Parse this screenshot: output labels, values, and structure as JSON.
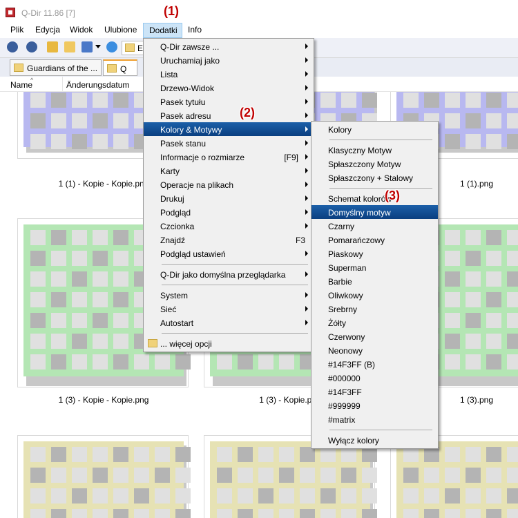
{
  "window": {
    "title": "Q-Dir 11.86 [7]"
  },
  "menubar": {
    "items": [
      "Plik",
      "Edycja",
      "Widok",
      "Ulubione",
      "Dodatki",
      "Info"
    ]
  },
  "address": {
    "value": "Ex"
  },
  "tabs": [
    {
      "label": "Guardians of the ..."
    },
    {
      "label": "Q"
    }
  ],
  "columns": {
    "name": "Name",
    "date": "Änderungsdatum"
  },
  "files": [
    {
      "name": "1 (1) - Kopie - Kopie.png"
    },
    {
      "name": "1 (1).png"
    },
    {
      "name": "1 (3) - Kopie - Kopie.png"
    },
    {
      "name": "1 (3) - Kopie.png"
    },
    {
      "name": "1 (3).png"
    }
  ],
  "dodatki_menu": [
    {
      "label": "Q-Dir zawsze ...",
      "submenu": true
    },
    {
      "label": "Uruchamiaj jako",
      "submenu": true
    },
    {
      "label": "Lista",
      "submenu": true
    },
    {
      "label": "Drzewo-Widok",
      "submenu": true
    },
    {
      "label": "Pasek tytułu",
      "submenu": true
    },
    {
      "label": "Pasek adresu",
      "submenu": true
    },
    {
      "label": "Kolory & Motywy",
      "submenu": true,
      "highlight": true
    },
    {
      "label": "Pasek stanu",
      "submenu": true
    },
    {
      "label": "Informacje o rozmiarze",
      "shortcut": "[F9]",
      "submenu": true
    },
    {
      "label": "Karty",
      "submenu": true
    },
    {
      "label": "Operacje na plikach",
      "submenu": true
    },
    {
      "label": "Drukuj",
      "submenu": true
    },
    {
      "label": "Podgląd",
      "submenu": true
    },
    {
      "label": "Czcionka",
      "submenu": true
    },
    {
      "label": "Znajdź",
      "shortcut": "F3"
    },
    {
      "label": "Podgląd ustawień",
      "submenu": true
    },
    {
      "label": "Q-Dir jako domyślna przeglądarka",
      "submenu": true
    },
    {
      "label": "System",
      "submenu": true
    },
    {
      "label": "Sieć",
      "submenu": true
    },
    {
      "label": "Autostart",
      "submenu": true
    },
    {
      "label": "... więcej opcji",
      "icon": "folder-icon"
    }
  ],
  "kolory_menu": [
    {
      "label": "Kolory"
    },
    {
      "label": "Klasyczny Motyw"
    },
    {
      "label": "Spłaszczony Motyw"
    },
    {
      "label": "Spłaszczony + Stalowy"
    },
    {
      "label": "Schemat kolorów"
    },
    {
      "label": "Domyślny motyw",
      "highlight": true
    },
    {
      "label": "Czarny"
    },
    {
      "label": "Pomarańczowy"
    },
    {
      "label": "Piaskowy"
    },
    {
      "label": "Superman"
    },
    {
      "label": "Barbie"
    },
    {
      "label": "Oliwkowy"
    },
    {
      "label": "Srebrny"
    },
    {
      "label": "Żółty"
    },
    {
      "label": "Czerwony"
    },
    {
      "label": "Neonowy"
    },
    {
      "label": "#14F3FF (B)"
    },
    {
      "label": "#000000"
    },
    {
      "label": "#14F3FF"
    },
    {
      "label": "#999999"
    },
    {
      "label": "#matrix"
    },
    {
      "label": "Wyłącz kolory"
    }
  ],
  "annotations": [
    "(1)",
    "(2)",
    "(3)"
  ],
  "colors": {
    "highlight": "#0a4a8f",
    "purple": "#b8b8f0",
    "green": "#b4e6b4",
    "khaki": "#e6e2b4",
    "cell": "#e0e0e0",
    "cell_dark": "#b4b4b4"
  }
}
